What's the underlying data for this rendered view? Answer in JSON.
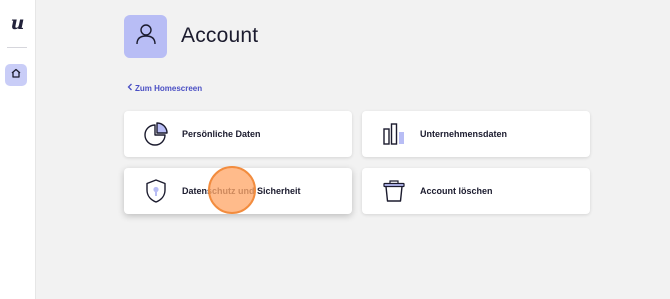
{
  "sidebar": {
    "logo_text": "u",
    "home_icon": "home-icon"
  },
  "header": {
    "title": "Account",
    "avatar_icon": "user-icon"
  },
  "back_link": {
    "label": "Zum Homescreen",
    "icon": "chevron-left-icon"
  },
  "cards": [
    {
      "label": "Persönliche Daten",
      "icon": "pie-chart-icon"
    },
    {
      "label": "Unternehmensdaten",
      "icon": "bar-chart-icon"
    },
    {
      "label": "Datenschutz und Sicherheit",
      "icon": "shield-icon"
    },
    {
      "label": "Account löschen",
      "icon": "trash-icon"
    }
  ],
  "colors": {
    "accent": "#4a4fc4",
    "accent_light": "#b8bdf5",
    "highlight": "#f28c3e"
  }
}
